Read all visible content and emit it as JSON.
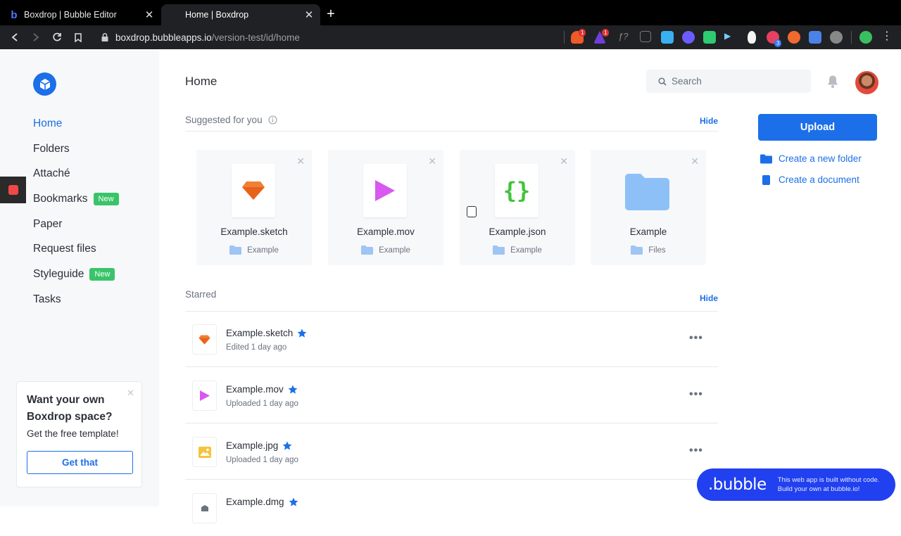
{
  "browser": {
    "tabs": [
      {
        "title": "Boxdrop | Bubble Editor",
        "active": false
      },
      {
        "title": "Home | Boxdrop",
        "active": true
      }
    ],
    "url_host": "boxdrop.bubbleapps.io",
    "url_path": "/version-test/id/home",
    "extension_badges": [
      "1",
      "1",
      "3"
    ]
  },
  "sidebar": {
    "nav": [
      {
        "label": "Home",
        "active": true
      },
      {
        "label": "Folders"
      },
      {
        "label": "Attaché"
      },
      {
        "label": "Bookmarks",
        "badge": "New"
      },
      {
        "label": "Paper"
      },
      {
        "label": "Request files"
      },
      {
        "label": "Styleguide",
        "badge": "New"
      },
      {
        "label": "Tasks"
      }
    ],
    "promo": {
      "title": "Want your own Boxdrop space?",
      "subtitle": "Get the free template!",
      "button": "Get that"
    }
  },
  "header": {
    "title": "Home",
    "search_placeholder": "Search"
  },
  "suggested": {
    "label": "Suggested for you",
    "hide": "Hide",
    "cards": [
      {
        "name": "Example.sketch",
        "location": "Example",
        "icon": "sketch-icon"
      },
      {
        "name": "Example.mov",
        "location": "Example",
        "icon": "play-icon"
      },
      {
        "name": "Example.json",
        "location": "Example",
        "icon": "json-icon"
      },
      {
        "name": "Example",
        "location": "Files",
        "icon": "folder-icon"
      }
    ]
  },
  "starred": {
    "label": "Starred",
    "hide": "Hide",
    "rows": [
      {
        "name": "Example.sketch",
        "meta": "Edited 1 day ago",
        "icon": "sketch-icon"
      },
      {
        "name": "Example.mov",
        "meta": "Uploaded 1 day ago",
        "icon": "play-icon"
      },
      {
        "name": "Example.jpg",
        "meta": "Uploaded 1 day ago",
        "icon": "image-icon"
      },
      {
        "name": "Example.dmg",
        "meta": "",
        "icon": "disk-icon"
      }
    ],
    "more": "•••"
  },
  "actions": {
    "upload": "Upload",
    "new_folder": "Create a new folder",
    "new_document": "Create a document"
  },
  "bubble": {
    "logo": ".bubble",
    "line1": "This web app is built without code.",
    "line2": "Build your own at bubble.io!"
  },
  "colors": {
    "accent": "#1c6fe8",
    "badge_green": "#39c46a",
    "bubble_blue": "#2140f0"
  }
}
